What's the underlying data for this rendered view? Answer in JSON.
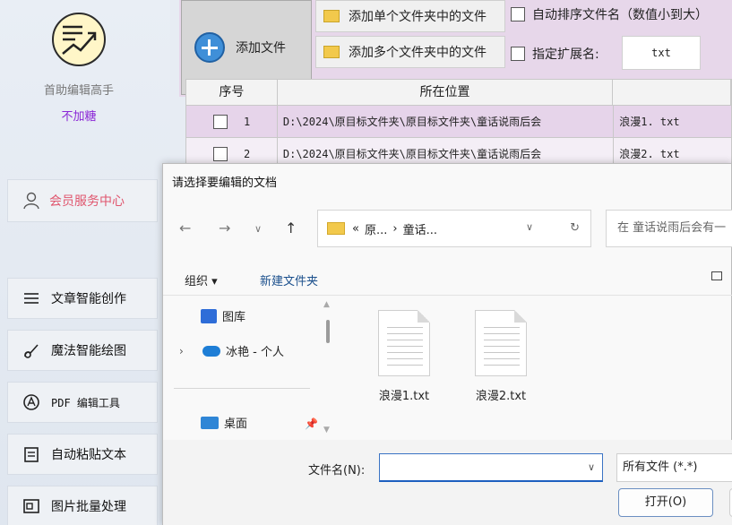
{
  "sidebar": {
    "app_name": "首助编辑高手",
    "app_tag": "不加糖",
    "member_label": "会员服务中心",
    "items": [
      {
        "label": "文章智能创作",
        "icon": "menu-lines-icon"
      },
      {
        "label": "魔法智能绘图",
        "icon": "brush-icon"
      },
      {
        "label": "PDF 编辑工具",
        "icon": "pdf-icon"
      },
      {
        "label": "自动粘贴文本",
        "icon": "paste-icon"
      },
      {
        "label": "图片批量处理",
        "icon": "image-icon"
      }
    ]
  },
  "toolbar": {
    "add_file": "添加文件",
    "add_single_folder": "添加单个文件夹中的文件",
    "add_multi_folder": "添加多个文件夹中的文件",
    "auto_sort": "自动排序文件名（数值小到大）",
    "specify_ext": "指定扩展名:",
    "ext_value": "txt"
  },
  "table": {
    "headers": [
      "序号",
      "所在位置",
      ""
    ],
    "rows": [
      {
        "no": "1",
        "path": "D:\\2024\\原目标文件夹\\原目标文件夹\\童话说雨后会",
        "name": "浪漫1. txt"
      },
      {
        "no": "2",
        "path": "D:\\2024\\原目标文件夹\\原目标文件夹\\童话说雨后会",
        "name": "浪漫2. txt"
      }
    ]
  },
  "dialog": {
    "title": "请选择要编辑的文档",
    "breadcrumb": {
      "prefix": "«",
      "seg1": "原...",
      "sep": "›",
      "seg2": "童话..."
    },
    "search_placeholder": "在 童话说雨后会有一",
    "organize": "组织 ▾",
    "new_folder": "新建文件夹",
    "nav": {
      "library": "图库",
      "cloud": "冰艳 - 个人",
      "desktop": "桌面"
    },
    "files": [
      {
        "name": "浪漫1.txt"
      },
      {
        "name": "浪漫2.txt"
      }
    ],
    "filename_label": "文件名(N):",
    "filename_value": "",
    "filetype": "所有文件 (*.*)",
    "open_label": "打开(O)"
  },
  "colors": {
    "accent_purple": "#8b27d6",
    "member_red": "#e0566e",
    "toolbar_bg": "#e7d7ea",
    "selected_row": "#e6d4ea"
  }
}
